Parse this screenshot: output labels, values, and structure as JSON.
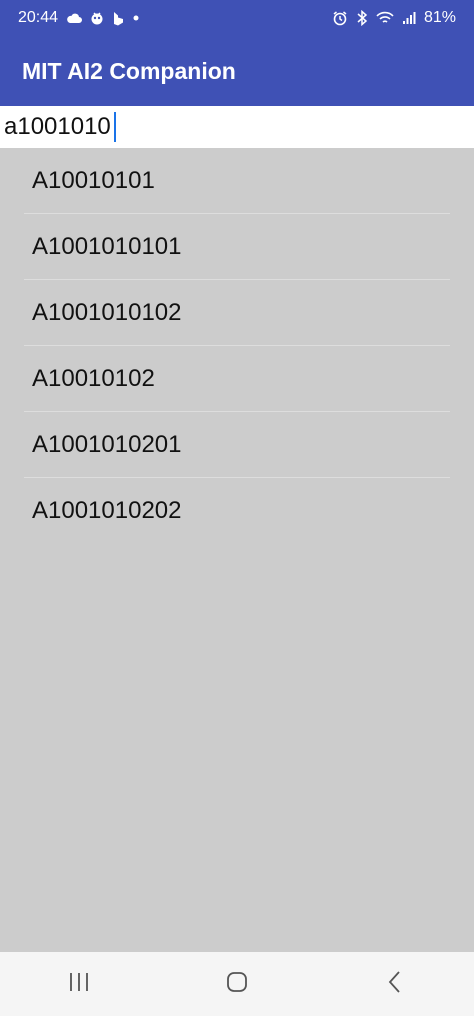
{
  "status_bar": {
    "time": "20:44",
    "battery": "81%",
    "left_icons": [
      "cloud-icon",
      "duolingo-icon",
      "bing-icon",
      "dot-icon"
    ],
    "right_icons": [
      "alarm-icon",
      "bluetooth-icon",
      "wifi-icon",
      "signal-icon"
    ]
  },
  "app_bar": {
    "title": "MIT AI2 Companion",
    "background": "#3f51b5"
  },
  "search": {
    "value": "a1001010"
  },
  "list": {
    "items": [
      {
        "label": "A10010101"
      },
      {
        "label": "A1001010101"
      },
      {
        "label": "A1001010102"
      },
      {
        "label": "A10010102"
      },
      {
        "label": "A1001010201"
      },
      {
        "label": "A1001010202"
      }
    ]
  },
  "nav_bar": {
    "buttons": [
      "recent-apps-icon",
      "home-icon",
      "back-icon"
    ]
  }
}
